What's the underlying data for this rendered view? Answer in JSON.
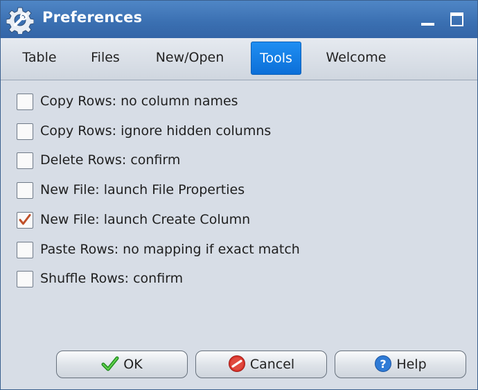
{
  "window": {
    "title": "Preferences"
  },
  "icons": {
    "app": "gear-wrench-icon",
    "minimize": "minimize-icon",
    "maximize": "maximize-icon",
    "ok": "green-check-icon",
    "cancel": "red-cancel-icon",
    "help": "question-icon"
  },
  "tabs": [
    {
      "label": "Table",
      "active": false
    },
    {
      "label": "Files",
      "active": false
    },
    {
      "label": "New/Open",
      "active": false
    },
    {
      "label": "Tools",
      "active": true
    },
    {
      "label": "Welcome",
      "active": false
    }
  ],
  "options": [
    {
      "label": "Copy Rows: no column names",
      "checked": false
    },
    {
      "label": "Copy Rows: ignore hidden columns",
      "checked": false
    },
    {
      "label": "Delete Rows: confirm",
      "checked": false
    },
    {
      "label": "New File: launch File Properties",
      "checked": false
    },
    {
      "label": "New File: launch Create Column",
      "checked": true
    },
    {
      "label": "Paste Rows: no mapping if exact match",
      "checked": false
    },
    {
      "label": "Shuffle Rows: confirm",
      "checked": false
    }
  ],
  "buttons": {
    "ok": "OK",
    "cancel": "Cancel",
    "help": "Help"
  },
  "colors": {
    "titlebar": "#3a6fb1",
    "active_tab": "#1486ee",
    "checkmark": "#c0502a"
  }
}
